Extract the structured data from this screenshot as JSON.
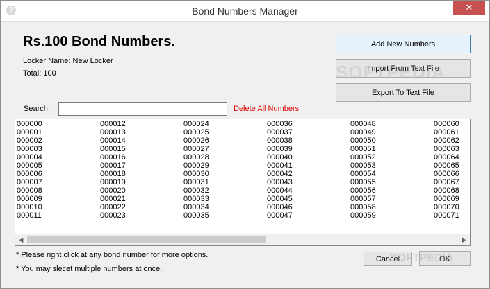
{
  "window": {
    "title": "Bond Numbers Manager",
    "icon_glyph": "?",
    "close_glyph": "✕"
  },
  "header": {
    "heading": "Rs.100 Bond Numbers.",
    "locker_line": "Locker Name: New Locker",
    "total_line": "Total: 100"
  },
  "actions": {
    "add_label": "Add New Numbers",
    "import_label": "Import From Text File",
    "export_label": "Export To Text File"
  },
  "search": {
    "label": "Search:",
    "value": "",
    "delete_all_label": "Delete All Numbers"
  },
  "list": {
    "columns": [
      [
        "000000",
        "000001",
        "000002",
        "000003",
        "000004",
        "000005",
        "000006",
        "000007",
        "000008",
        "000009",
        "000010",
        "000011"
      ],
      [
        "000012",
        "000013",
        "000014",
        "000015",
        "000016",
        "000017",
        "000018",
        "000019",
        "000020",
        "000021",
        "000022",
        "000023"
      ],
      [
        "000024",
        "000025",
        "000026",
        "000027",
        "000028",
        "000029",
        "000030",
        "000031",
        "000032",
        "000033",
        "000034",
        "000035"
      ],
      [
        "000036",
        "000037",
        "000038",
        "000039",
        "000040",
        "000041",
        "000042",
        "000043",
        "000044",
        "000045",
        "000046",
        "000047"
      ],
      [
        "000048",
        "000049",
        "000050",
        "000051",
        "000052",
        "000053",
        "000054",
        "000055",
        "000056",
        "000057",
        "000058",
        "000059"
      ],
      [
        "000060",
        "000061",
        "000062",
        "000063",
        "000064",
        "000065",
        "000066",
        "000067",
        "000068",
        "000069",
        "000070",
        "000071"
      ]
    ],
    "scroll_left_glyph": "◀",
    "scroll_right_glyph": "▶"
  },
  "notes": {
    "note1": "* Please right click at any bond number for more options.",
    "note2": "* You may slecet multiple numbers at once."
  },
  "footer": {
    "cancel_label": "Cancel",
    "ok_label": "OK"
  },
  "watermark": {
    "text": "SOFTPEDIA",
    "text2": "SOFTPEDIA"
  }
}
